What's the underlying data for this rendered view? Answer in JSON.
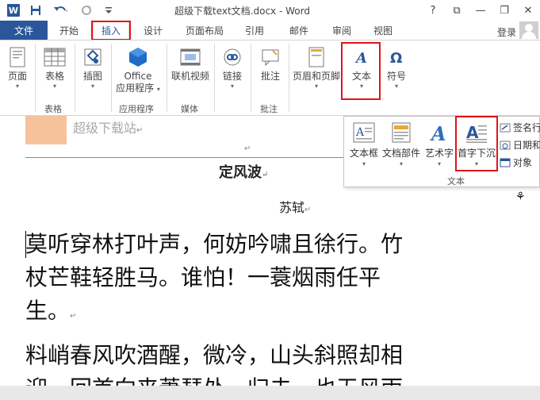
{
  "title_bar": {
    "doc_title": "超级下载text文档.docx - Word",
    "help": "?",
    "ribbon_display": "⧉",
    "minimize": "—",
    "restore": "❐",
    "close": "✕"
  },
  "tabs": [
    {
      "label": "文件"
    },
    {
      "label": "开始"
    },
    {
      "label": "插入"
    },
    {
      "label": "设计"
    },
    {
      "label": "页面布局"
    },
    {
      "label": "引用"
    },
    {
      "label": "邮件"
    },
    {
      "label": "审阅"
    },
    {
      "label": "视图"
    }
  ],
  "account": {
    "login": "登录"
  },
  "ribbon": {
    "buttons": [
      {
        "label": "页面"
      },
      {
        "label": "表格"
      },
      {
        "label": "插图"
      },
      {
        "label": "Office",
        "label2": "应用程序"
      },
      {
        "label": "联机视频"
      },
      {
        "label": "链接"
      },
      {
        "label": "批注"
      },
      {
        "label": "页眉和页脚"
      },
      {
        "label": "文本"
      },
      {
        "label": "符号"
      }
    ],
    "groups": [
      "表格",
      "应用程序",
      "媒体",
      "批注"
    ]
  },
  "dropdown": {
    "buttons": [
      {
        "label": "文本框"
      },
      {
        "label": "文档部件"
      },
      {
        "label": "艺术字"
      },
      {
        "label": "首字下沉"
      }
    ],
    "side_items": [
      "签名行",
      "日期和",
      "对象"
    ],
    "group_label": "文本"
  },
  "document": {
    "site_name": "超级下载站",
    "poem_title": "定风波",
    "author": "苏轼",
    "para1_line1": "莫听穿林打叶声，何妨吟啸且徐行。竹",
    "para1_line2": "杖芒鞋轻胜马。谁怕！一蓑烟雨任平",
    "para1_line3": "生。",
    "para2_line1": "料峭春风吹酒醒，微冷，山头斜照却相",
    "para2_line2": "迎。回首向来萧瑟处，归去，也无风雨",
    "return_mark": "↵",
    "border_glyphs": "⚘⚘⚘⚘⚘⚘⚘⚘⚘⚘⚘⚘⚘⚘⚘⚘"
  }
}
